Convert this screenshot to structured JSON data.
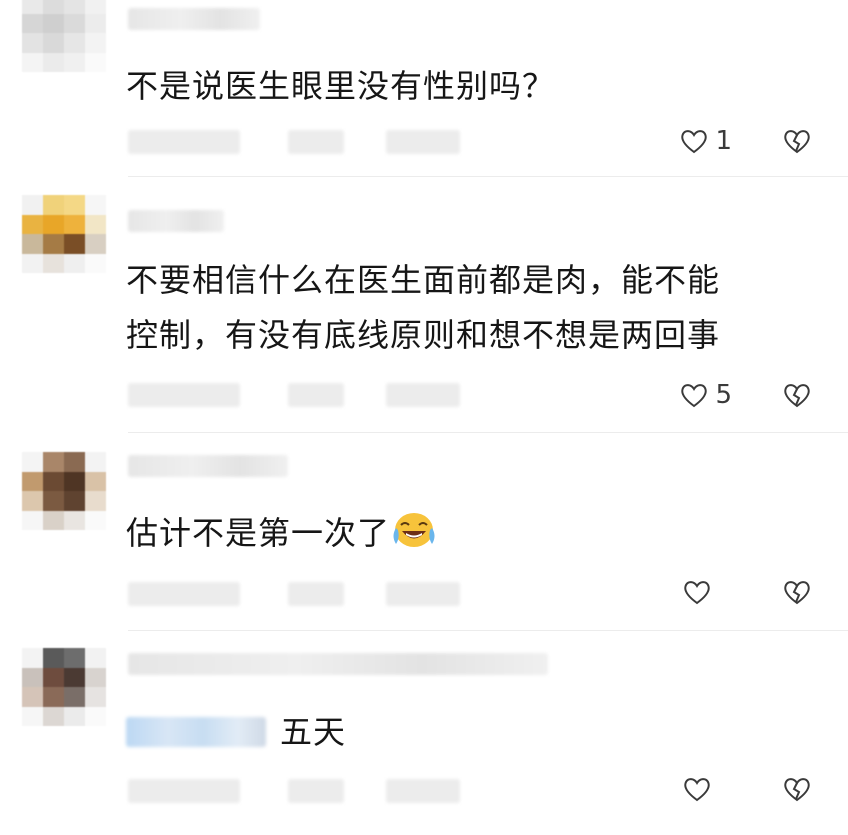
{
  "comments": [
    {
      "text": "不是说医生眼里没有性别吗？",
      "likes": "1"
    },
    {
      "text_line1": "不要相信什么在医生面前都是肉，能不能",
      "text_line2": "控制，有没有底线原则和想不想是两回事",
      "likes": "5"
    },
    {
      "text": "估计不是第一次了",
      "emoji": "rolling-on-floor-laughing-emoji",
      "likes": ""
    },
    {
      "text": "五天",
      "likes": ""
    }
  ],
  "icons": {
    "like": "heart-outline-icon",
    "dislike": "broken-heart-outline-icon"
  },
  "colors": {
    "text": "#161616",
    "icon": "#3a3a3a",
    "blur": "#ececec"
  }
}
